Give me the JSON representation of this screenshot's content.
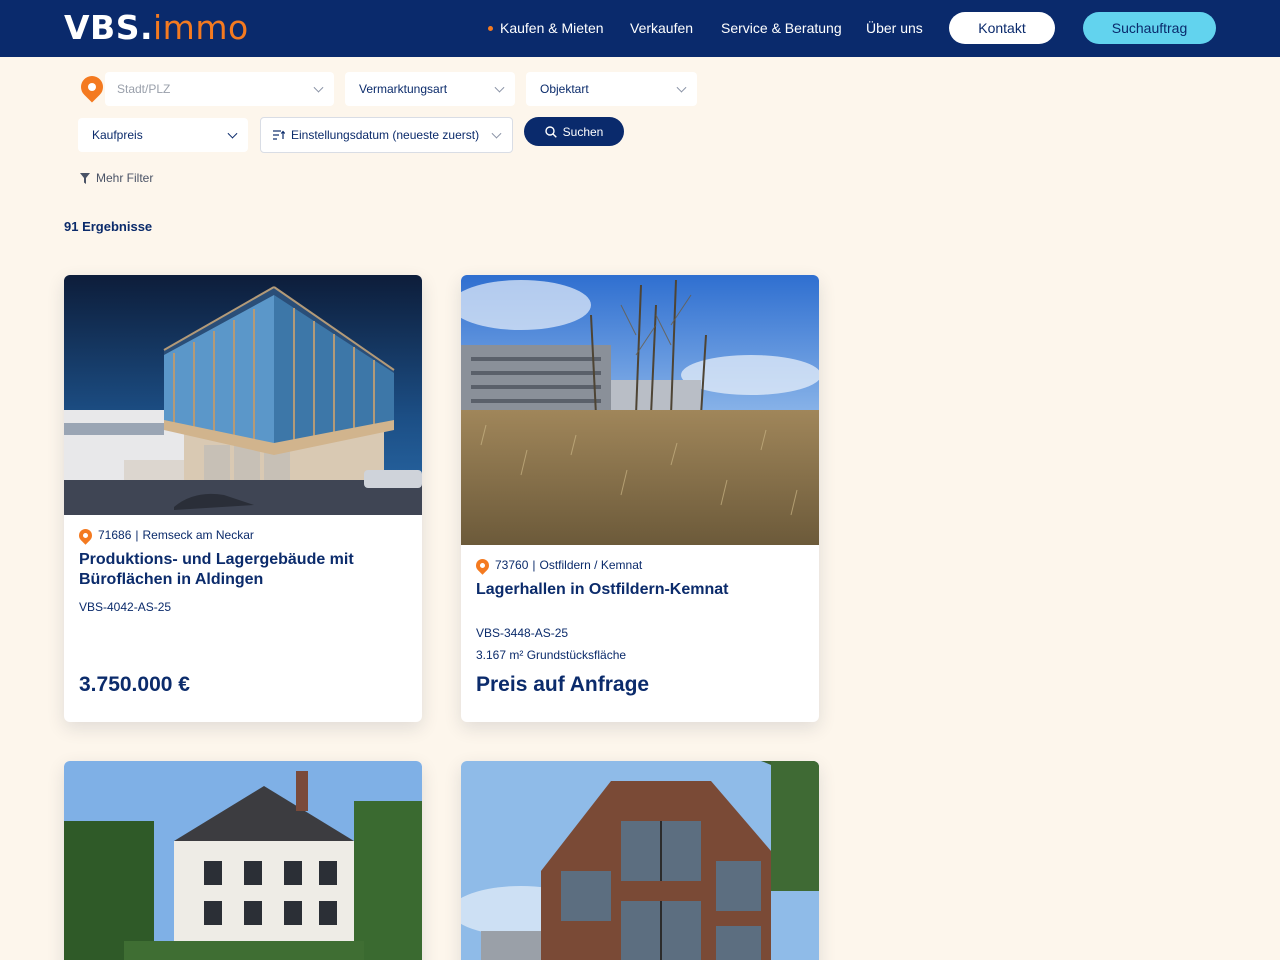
{
  "header": {
    "logo_main": "VBS.",
    "logo_accent": "immo",
    "nav": [
      "Kaufen & Mieten",
      "Verkaufen",
      "Service & Beratung",
      "Über uns"
    ],
    "kontakt_label": "Kontakt",
    "suchauftrag_label": "Suchauftrag",
    "accent_color": "#f47a20",
    "brand_color": "#0a2a6c"
  },
  "filters": {
    "location_placeholder": "Stadt/PLZ",
    "vermarktungsart": "Vermarktungsart",
    "objektart": "Objektart",
    "kaufpreis": "Kaufpreis",
    "sort": "Einstellungsdatum (neueste zuerst)",
    "search_label": "Suchen",
    "mehr_filter": "Mehr Filter"
  },
  "results": {
    "count_label": "91 Ergebnisse"
  },
  "listings": [
    {
      "plz": "71686",
      "city": "Remseck am Neckar",
      "title": "Produktions- und Lagergebäude mit Büroflächen in Aldingen",
      "ref": "VBS-4042-AS-25",
      "area": "",
      "price": "3.750.000 €"
    },
    {
      "plz": "73760",
      "city": "Ostfildern / Kemnat",
      "title": "Lagerhallen in Ostfildern-Kemnat",
      "ref": "VBS-3448-AS-25",
      "area": "3.167 m² Grundstücksfläche",
      "price": "Preis auf Anfrage"
    }
  ]
}
